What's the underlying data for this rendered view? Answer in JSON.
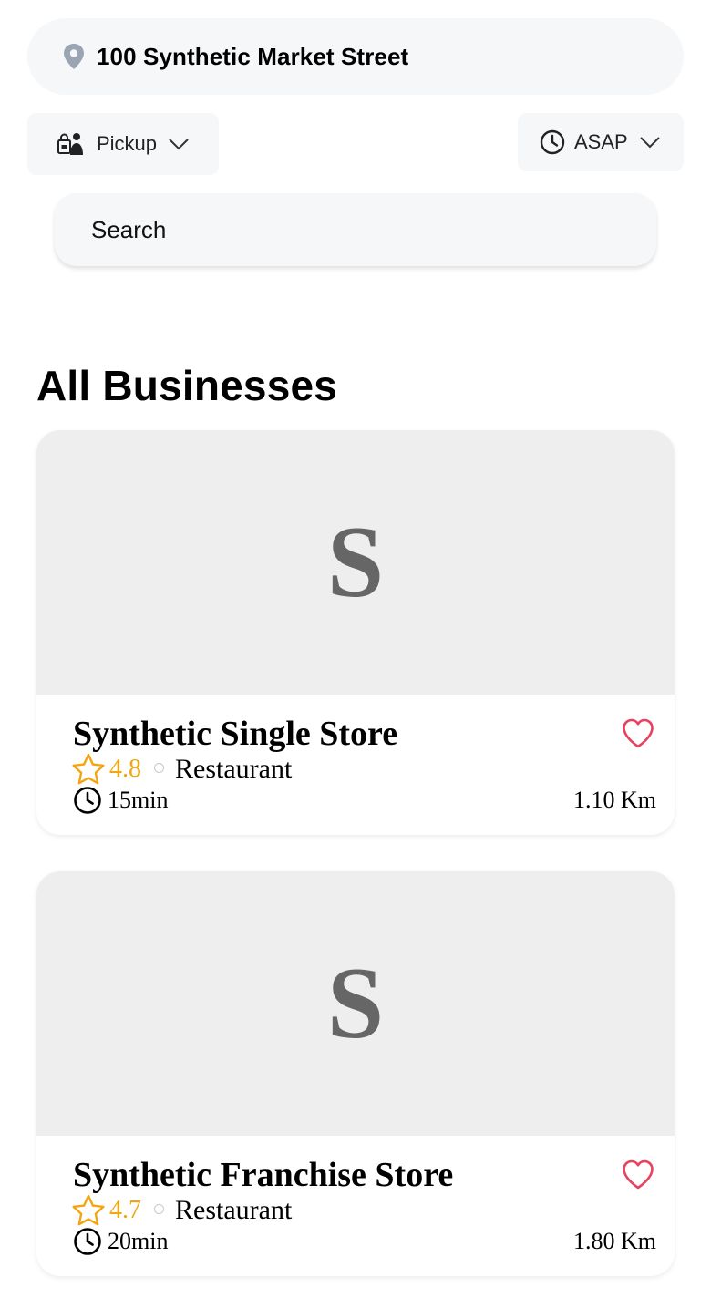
{
  "header": {
    "address": "100 Synthetic Market Street",
    "address_icon": "location-pin-icon",
    "order_type": "Pickup",
    "time": "ASAP"
  },
  "search": {
    "placeholder": "Search"
  },
  "section": {
    "title": "All Businesses"
  },
  "businesses": [
    {
      "initial": "S",
      "name": "Synthetic Single Store",
      "rating": "4.8",
      "category": "Restaurant",
      "eta": "15min",
      "distance": "1.10 Km"
    },
    {
      "initial": "S",
      "name": "Synthetic Franchise Store",
      "rating": "4.7",
      "category": "Restaurant",
      "eta": "20min",
      "distance": "1.80 Km"
    }
  ],
  "colors": {
    "rating": "#f2a50f",
    "heart": "#e8425f",
    "pin": "#9aa4b2",
    "cover": "#eeeeee",
    "pill_bg": "#f6f7f9"
  }
}
